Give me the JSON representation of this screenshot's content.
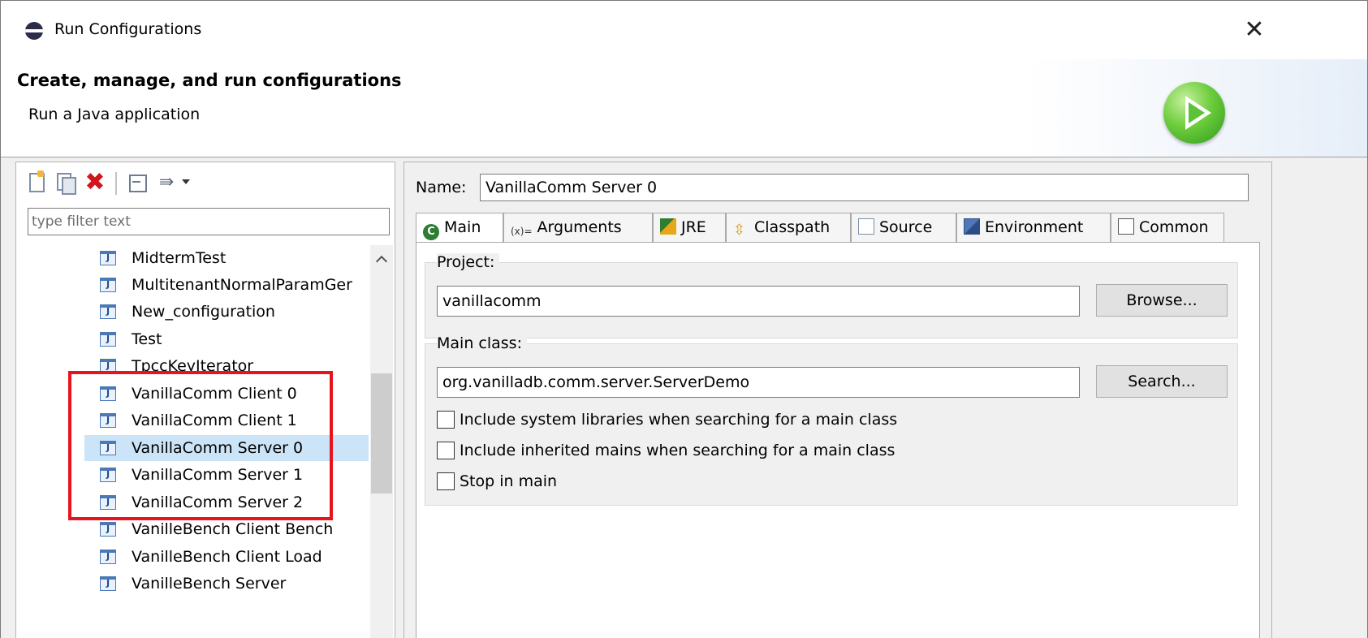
{
  "window": {
    "title": "Run Configurations",
    "close_glyph": "✕"
  },
  "banner": {
    "title": "Create, manage, and run configurations",
    "description": "Run a Java application"
  },
  "left": {
    "toolbar": [
      "new-configuration-icon",
      "duplicate-icon",
      "delete-icon",
      "collapse-all-icon",
      "filter-icon",
      "view-menu-icon"
    ],
    "filter_placeholder": "type filter text",
    "items": [
      {
        "label": "MidtermTest"
      },
      {
        "label": "MultitenantNormalParamGer"
      },
      {
        "label": "New_configuration"
      },
      {
        "label": "Test"
      },
      {
        "label": "TpccKeyIterator"
      },
      {
        "label": "VanillaComm Client 0"
      },
      {
        "label": "VanillaComm Client 1"
      },
      {
        "label": "VanillaComm Server 0",
        "selected": true
      },
      {
        "label": "VanillaComm Server 1"
      },
      {
        "label": "VanillaComm Server 2"
      },
      {
        "label": "VanilleBench Client Bench"
      },
      {
        "label": "VanilleBench Client Load"
      },
      {
        "label": "VanilleBench Server"
      }
    ]
  },
  "right": {
    "name_label": "Name:",
    "name_value": "VanillaComm Server 0",
    "tabs": [
      {
        "label": "Main",
        "icon": "main-icon",
        "active": true
      },
      {
        "label": "Arguments",
        "icon": "arguments-icon",
        "prefix": "(x)="
      },
      {
        "label": "JRE",
        "icon": "jre-icon"
      },
      {
        "label": "Classpath",
        "icon": "classpath-icon"
      },
      {
        "label": "Source",
        "icon": "source-icon"
      },
      {
        "label": "Environment",
        "icon": "environment-icon"
      },
      {
        "label": "Common",
        "icon": "common-icon"
      }
    ],
    "project": {
      "label": "Project:",
      "value": "vanillacomm",
      "button": "Browse..."
    },
    "main_class": {
      "label": "Main class:",
      "value": "org.vanilladb.comm.server.ServerDemo",
      "button": "Search..."
    },
    "checkboxes": [
      {
        "label": "Include system libraries when searching for a main class",
        "checked": false
      },
      {
        "label": "Include inherited mains when searching for a main class",
        "checked": false
      },
      {
        "label": "Stop in main",
        "checked": false
      }
    ]
  },
  "colors": {
    "highlight": "#e8141d",
    "selection": "#cce4f7",
    "run_badge": "#4caf2a"
  }
}
